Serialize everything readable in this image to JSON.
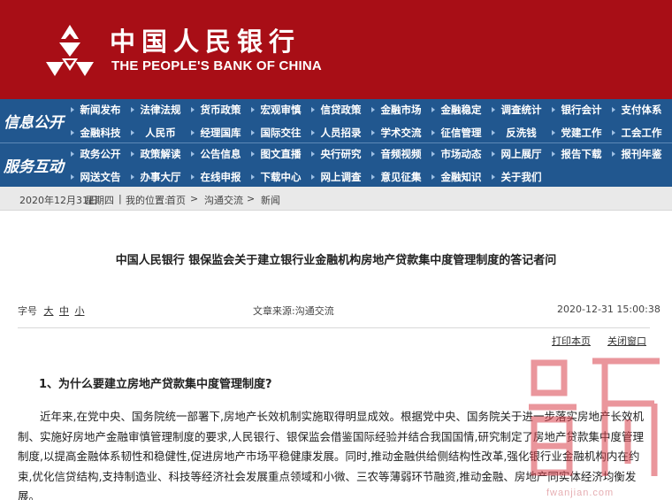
{
  "header": {
    "brand_cn": "中国人民银行",
    "brand_en": "THE PEOPLE'S BANK OF CHINA",
    "logo_icon": "pboc-emblem-icon",
    "bg_color": "#a80e16"
  },
  "nav": {
    "bg_color": "#21578f",
    "group1_label": "信息公开",
    "group2_label": "服务互动",
    "row1": [
      "新闻发布",
      "法律法规",
      "货币政策",
      "宏观审慎",
      "信贷政策",
      "金融市场",
      "金融稳定",
      "调查统计",
      "银行会计",
      "支付体系"
    ],
    "row2": [
      "金融科技",
      "人民币",
      "经理国库",
      "国际交往",
      "人员招录",
      "学术交流",
      "征信管理",
      "反洗钱",
      "党建工作",
      "工会工作"
    ],
    "row3": [
      "政务公开",
      "政策解读",
      "公告信息",
      "图文直播",
      "央行研究",
      "音频视频",
      "市场动态",
      "网上展厅",
      "报告下载",
      "报刊年鉴"
    ],
    "row4": [
      "网送文告",
      "办事大厅",
      "在线申报",
      "下载中心",
      "网上调查",
      "意见征集",
      "金融知识",
      "关于我们"
    ]
  },
  "breadcrumb": {
    "date": "2020年12月31日",
    "weekday": "星期四",
    "sep": "|",
    "location_label": "我的位置:",
    "home": "首页",
    "arrow": ">",
    "section": "沟通交流",
    "page": "新闻"
  },
  "article": {
    "title": "中国人民银行 银保监会关于建立银行业金融机构房地产贷款集中度管理制度的答记者问",
    "font_size_label": "字号",
    "size_large": "大",
    "size_medium": "中",
    "size_small": "小",
    "source_label": "文章来源:",
    "source": "沟通交流",
    "datetime": "2020-12-31 15:00:38",
    "print_link": "打印本页",
    "close_link": "关闭窗口",
    "q1": "1、为什么要建立房地产贷款集中度管理制度?",
    "p1": "近年来,在党中央、国务院统一部署下,房地产长效机制实施取得明显成效。根据党中央、国务院关于进一步落实房地产长效机制、实施好房地产金融审慎管理制度的要求,人民银行、银保监会借鉴国际经验并结合我国国情,研究制定了房地产贷款集中度管理制度,以提高金融体系韧性和稳健性,促进房地产市场平稳健康发展。同时,推动金融供给侧结构性改革,强化银行业金融机构内在约束,优化信贷结构,支持制造业、科技等经济社会发展重点领域和小微、三农等薄弱环节融资,推动金融、房地产同实体经济均衡发展。"
  },
  "watermark": {
    "url": "fwanjian.com",
    "color": "#d9414d"
  }
}
